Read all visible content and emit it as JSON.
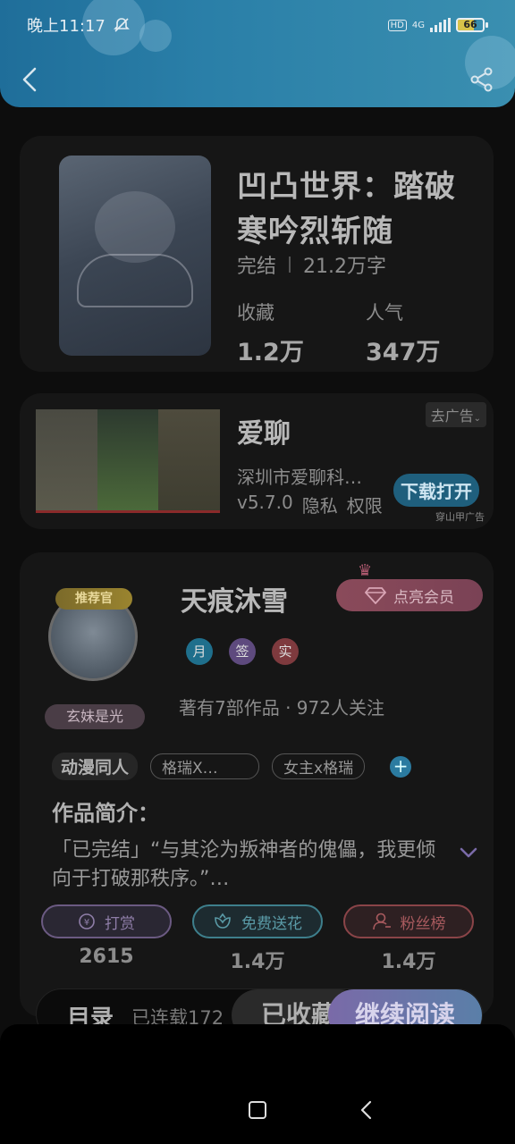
{
  "status_bar": {
    "time": "晚上11:17",
    "hd": "HD",
    "network": "4G",
    "battery_level": "66"
  },
  "book": {
    "title": "凹凸世界：踏破寒吟烈斩随",
    "status": "完结",
    "word_count": "21.2万字",
    "favorites_label": "收藏",
    "favorites_value": "1.2万",
    "popularity_label": "人气",
    "popularity_value": "347万"
  },
  "ad": {
    "title": "爱聊",
    "company": "深圳市爱聊科…",
    "version": "v5.7.0",
    "privacy": "隐私",
    "permissions": "权限",
    "skip_label": "去广告",
    "download_label": "下载打开",
    "source": "穿山甲广告"
  },
  "author": {
    "name": "天痕沐雪",
    "recommend_badge": "推荐官",
    "fan_name": "玄妹是光",
    "vip_label": "点亮会员",
    "badges": [
      "月",
      "签",
      "实"
    ],
    "stats": "著有7部作品 · 972人关注",
    "tags": {
      "main": "动漫同人",
      "tag1": "格瑞X…",
      "tag2": "女主x格瑞"
    }
  },
  "intro": {
    "heading": "作品简介：",
    "text": "「已完结」“与其沦为叛神者的傀儡，我更倾向于打破那秩序。”…"
  },
  "actions": {
    "reward_label": "打赏",
    "reward_count": "2615",
    "flower_label": "免费送花",
    "flower_count": "1.4万",
    "fans_label": "粉丝榜",
    "fans_count": "1.4万"
  },
  "bottom": {
    "toc_label": "目录",
    "serial_label": "已连载172",
    "collected_label": "已收藏",
    "continue_label": "继续阅读"
  },
  "colors": {
    "header": "#2a7fa8",
    "accent_purple": "#7a6aa8",
    "accent_teal": "#3e7f8c",
    "accent_red": "#8a4448"
  }
}
